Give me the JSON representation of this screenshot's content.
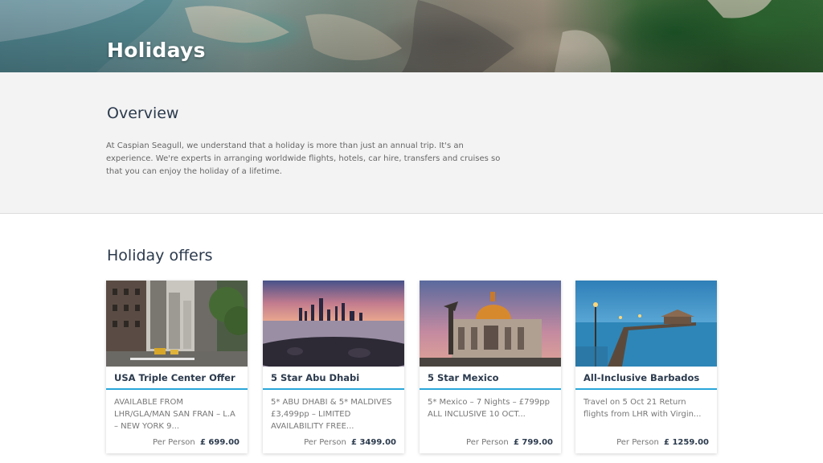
{
  "hero": {
    "title": "Holidays"
  },
  "overview": {
    "heading": "Overview",
    "text": "At Caspian Seagull, we understand that a holiday is more than just an annual trip. It's an experience. We're experts in arranging worldwide flights, hotels, car hire, transfers and cruises so that you can enjoy the holiday of a lifetime."
  },
  "offers": {
    "heading": "Holiday offers",
    "per_person_label": "Per Person",
    "items": [
      {
        "title": "USA Triple Center Offer",
        "description": "AVAILABLE FROM LHR/GLA/MAN SAN FRAN – L.A – NEW YORK 9...",
        "price": "£ 699.00",
        "image": "new-york-street-photo"
      },
      {
        "title": "5 Star Abu Dhabi",
        "description": "5* ABU DHABI & 5* MALDIVES £3,499pp – LIMITED AVAILABILITY FREE...",
        "price": "£ 3499.00",
        "image": "abu-dhabi-skyline-photo"
      },
      {
        "title": "5 Star Mexico",
        "description": "5* Mexico – 7 Nights – £799pp ALL INCLUSIVE 10 OCT...",
        "price": "£ 799.00",
        "image": "mexico-palace-photo"
      },
      {
        "title": "All-Inclusive Barbados",
        "description": "Travel on 5 Oct 21 Return flights from LHR with Virgin...",
        "price": "£ 1259.00",
        "image": "barbados-pier-photo"
      }
    ]
  },
  "colors": {
    "accent": "#29a7d9",
    "heading": "#2b3a4d"
  }
}
